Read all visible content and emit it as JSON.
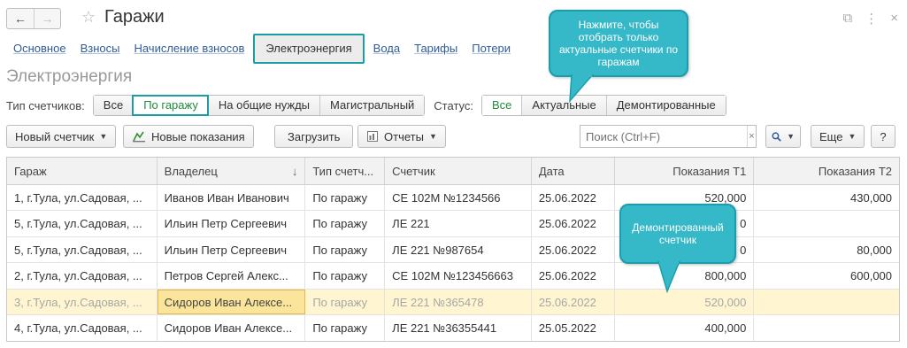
{
  "window": {
    "title": "Гаражи",
    "back_icon": "←",
    "forward_icon": "→",
    "star_icon": "☆",
    "link_icon": "⧉",
    "more_icon": "⋮",
    "close_icon": "×"
  },
  "tabs": [
    {
      "label": "Основное"
    },
    {
      "label": "Взносы"
    },
    {
      "label": "Начисление взносов"
    },
    {
      "label": "Электроэнергия"
    },
    {
      "label": "Вода"
    },
    {
      "label": "Тарифы"
    },
    {
      "label": "Потери"
    }
  ],
  "section_title": "Электроэнергия",
  "filters": {
    "meter_type_label": "Тип счетчиков:",
    "meter_types": [
      "Все",
      "По гаражу",
      "На общие нужды",
      "Магистральный"
    ],
    "status_label": "Статус:",
    "statuses": [
      "Все",
      "Актуальные",
      "Демонтированные"
    ]
  },
  "toolbar": {
    "new_meter": "Новый счетчик",
    "new_readings": "Новые показания",
    "load": "Загрузить",
    "reports": "Отчеты",
    "search_placeholder": "Поиск (Ctrl+F)",
    "search_clear": "×",
    "search_icon": "🔍",
    "more": "Еще",
    "help": "?"
  },
  "table": {
    "columns": [
      "Гараж",
      "Владелец",
      "Тип счетч...",
      "Счетчик",
      "Дата",
      "Показания Т1",
      "Показания Т2"
    ],
    "sort_indicator": "↓",
    "rows": [
      [
        "1, г.Тула, ул.Садовая, ...",
        "Иванов Иван Иванович",
        "По гаражу",
        "СЕ 102М №1234566",
        "25.06.2022",
        "520,000",
        "430,000"
      ],
      [
        "5, г.Тула, ул.Садовая, ...",
        "Ильин Петр Сергеевич",
        "По гаражу",
        "ЛЕ 221",
        "25.06.2022",
        "0",
        ""
      ],
      [
        "5, г.Тула, ул.Садовая, ...",
        "Ильин Петр Сергеевич",
        "По гаражу",
        "ЛЕ 221 №987654",
        "25.06.2022",
        "0",
        "80,000"
      ],
      [
        "2, г.Тула, ул.Садовая, ...",
        "Петров Сергей Алекс...",
        "По гаражу",
        "СЕ 102М №123456663",
        "25.06.2022",
        "800,000",
        "600,000"
      ],
      [
        "3, г.Тула, ул.Садовая, ...",
        "Сидоров Иван Алексе...",
        "По гаражу",
        "ЛЕ 221 №365478",
        "25.06.2022",
        "520,000",
        ""
      ],
      [
        "4, г.Тула, ул.Садовая, ...",
        "Сидоров Иван Алексе...",
        "По гаражу",
        "ЛЕ 221 №36355441",
        "25.05.2022",
        "400,000",
        ""
      ]
    ]
  },
  "callouts": {
    "filter_hint": "Нажмите, чтобы отобрать только актуальные счетчики по гаражам",
    "dismantled_hint": "Демонтированный счетчик"
  },
  "colors": {
    "accent": "#199fa3",
    "callout": "#35b8c8",
    "link": "#2f5c9a",
    "selected_row": "#fff6d1"
  }
}
